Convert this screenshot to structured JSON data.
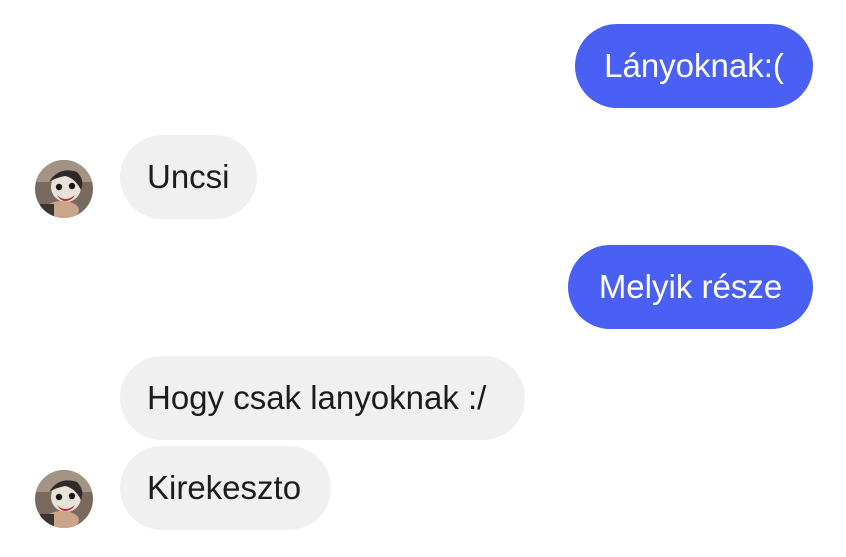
{
  "messages": [
    {
      "id": "m1",
      "direction": "outgoing",
      "text": "Lányoknak:("
    },
    {
      "id": "m2",
      "direction": "incoming",
      "text": "Uncsi"
    },
    {
      "id": "m3",
      "direction": "outgoing",
      "text": "Melyik része"
    },
    {
      "id": "m4",
      "direction": "incoming",
      "text": "Hogy csak lanyoknak :/"
    },
    {
      "id": "m5",
      "direction": "incoming",
      "text": "Kirekeszto"
    }
  ],
  "colors": {
    "outgoing_bubble": "#4a60f5",
    "incoming_bubble": "#f0f0f0",
    "outgoing_text": "#ffffff",
    "incoming_text": "#1c1c1c"
  },
  "icons": {
    "contact_avatar": "avatar-photo"
  }
}
